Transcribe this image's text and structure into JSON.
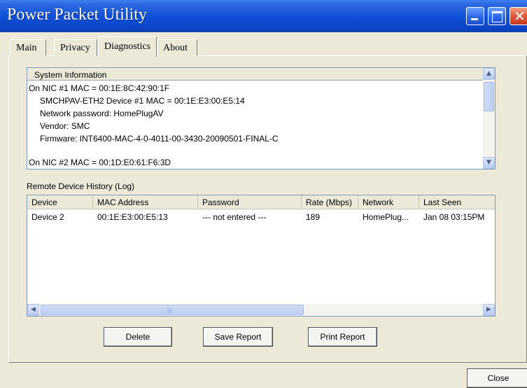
{
  "window": {
    "title": "Power Packet Utility"
  },
  "tabs": [
    {
      "label": "Main"
    },
    {
      "label": "Privacy"
    },
    {
      "label": "Diagnostics"
    },
    {
      "label": "About"
    }
  ],
  "system_info": {
    "header": "System Information",
    "lines": [
      "On NIC #1 MAC = 00:1E:8C:42:90:1F",
      "SMCHPAV-ETH2 Device #1 MAC = 00:1E:E3:00:E5:14",
      "Network password: HomePlugAV",
      "Vendor: SMC",
      "Firmware: INT6400-MAC-4-0-4011-00-3430-20090501-FINAL-C",
      "On NIC #2 MAC = 00:1D:E0:61:F6:3D"
    ]
  },
  "log": {
    "label": "Remote Device History (Log)",
    "columns": [
      "Device",
      "MAC Address",
      "Password",
      "Rate (Mbps)",
      "Network",
      "Last Seen"
    ],
    "rows": [
      [
        "Device 2",
        "00:1E:E3:00:E5:13",
        "--- not entered ---",
        "189",
        "HomePlug...",
        "Jan 08 03:15PM"
      ]
    ]
  },
  "buttons": {
    "delete": "Delete",
    "save_report": "Save Report",
    "print_report": "Print Report",
    "close": "Close"
  },
  "icons": {
    "scroll_up": "▲",
    "scroll_down": "▼",
    "scroll_left": "◀",
    "scroll_right": "▶",
    "window_close": "✕"
  }
}
